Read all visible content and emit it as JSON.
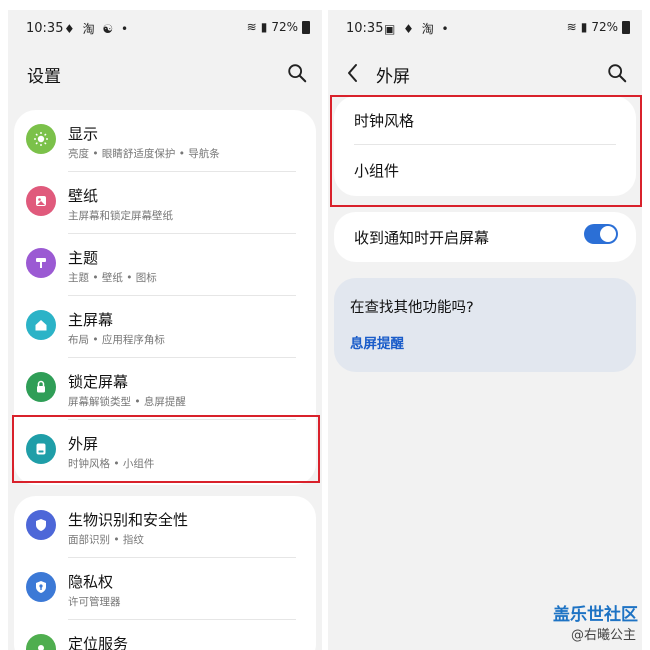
{
  "left": {
    "status": {
      "time": "10:35",
      "icons": "♦ 淘 ☯ •",
      "battery": "72%"
    },
    "title": "设置",
    "items": [
      {
        "label": "显示",
        "sub": "亮度 • 眼睛舒适度保护 • 导航条",
        "color": "#7bc14a",
        "icon": "sun-icon"
      },
      {
        "label": "壁纸",
        "sub": "主屏幕和锁定屏幕壁纸",
        "color": "#e05a7c",
        "icon": "wallpaper-icon"
      },
      {
        "label": "主题",
        "sub": "主题 • 壁纸 • 图标",
        "color": "#9b5ad3",
        "icon": "theme-brush-icon"
      },
      {
        "label": "主屏幕",
        "sub": "布局 • 应用程序角标",
        "color": "#2bb3c7",
        "icon": "home-icon"
      },
      {
        "label": "锁定屏幕",
        "sub": "屏幕解锁类型 • 息屏提醒",
        "color": "#2f9e57",
        "icon": "lock-icon"
      },
      {
        "label": "外屏",
        "sub": "时钟风格 • 小组件",
        "color": "#1f9ea8",
        "icon": "cover-screen-icon"
      },
      {
        "label": "生物识别和安全性",
        "sub": "面部识别 • 指纹",
        "color": "#4d67d8",
        "icon": "shield-icon"
      },
      {
        "label": "隐私权",
        "sub": "许可管理器",
        "color": "#3c79d6",
        "icon": "privacy-icon"
      },
      {
        "label": "定位服务",
        "sub": "",
        "color": "#4fae4f",
        "icon": "location-icon"
      }
    ]
  },
  "right": {
    "status": {
      "time": "10:35",
      "icons": "▣ ♦ 淘 •",
      "battery": "72%"
    },
    "title": "外屏",
    "items": [
      {
        "label": "时钟风格"
      },
      {
        "label": "小组件"
      }
    ],
    "toggle_label": "收到通知时开启屏幕",
    "toggle_on": true,
    "hint_question": "在查找其他功能吗?",
    "hint_link": "息屏提醒"
  },
  "watermark": {
    "line1": "盖乐世社区",
    "line2": "@右曦公主"
  },
  "colors": {
    "accent": "#2b6fd6",
    "highlight": "#d9212b"
  }
}
